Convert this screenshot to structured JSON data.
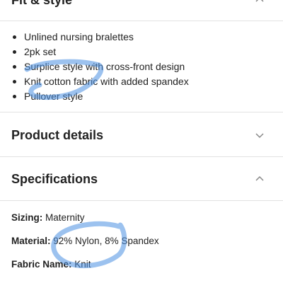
{
  "sections": {
    "fit_style": {
      "title": "Fit & style",
      "bullets": [
        "Unlined nursing bralettes",
        "2pk set",
        "Surplice style with cross-front design",
        "Knit cotton fabric with added spandex",
        "Pullover style"
      ],
      "expanded": true
    },
    "product_details": {
      "title": "Product details",
      "expanded": false
    },
    "specifications": {
      "title": "Specifications",
      "expanded": true,
      "rows": [
        {
          "label": "Sizing:",
          "value": " Maternity"
        },
        {
          "label": "Material:",
          "value": " 92% Nylon, 8% Spandex"
        },
        {
          "label": "Fabric Name:",
          "value": " Knit"
        }
      ]
    }
  },
  "icons": {
    "collapse": "chevron-up-icon",
    "expand": "chevron-down-icon"
  },
  "colors": {
    "text": "#222222",
    "divider": "#e2e2e2",
    "chevron": "#888888",
    "markup_highlight": "#4a90e2"
  }
}
